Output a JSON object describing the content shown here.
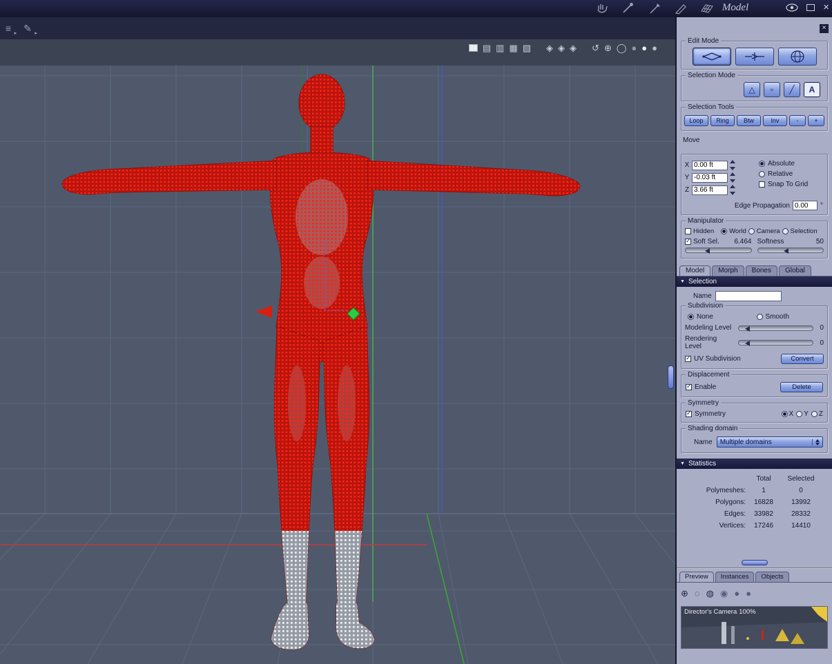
{
  "titlebar": {
    "title": "Model",
    "close": "×"
  },
  "viewport": {
    "left_tools": [
      {
        "name": "mixer-tool-icon",
        "glyph": "≡",
        "arrow": "▸"
      },
      {
        "name": "pen-tool-icon",
        "glyph": "✎",
        "arrow": "▸"
      }
    ],
    "toolbar": [
      {
        "name": "display-split-2-icon",
        "glyph": "▤"
      },
      {
        "name": "display-split-3-icon",
        "glyph": "▥"
      },
      {
        "name": "display-split-4-icon",
        "glyph": "▦"
      },
      {
        "name": "display-split-grid-icon",
        "glyph": "▧"
      },
      {
        "name": "shade-facet-1-icon",
        "glyph": "◈"
      },
      {
        "name": "shade-facet-2-icon",
        "glyph": "◈"
      },
      {
        "name": "shade-facet-3-icon",
        "glyph": "◈"
      },
      {
        "name": "orbit-icon",
        "glyph": "↺"
      },
      {
        "name": "dotted-cross-icon",
        "glyph": "⊕"
      },
      {
        "name": "wire-sphere-icon",
        "glyph": "◯"
      },
      {
        "name": "gray-sphere-icon",
        "glyph": "●"
      },
      {
        "name": "white-sphere-icon",
        "glyph": "●"
      },
      {
        "name": "shaded-sphere-icon",
        "glyph": "●"
      }
    ]
  },
  "panel": {
    "close": "×",
    "edit_mode": {
      "label": "Edit Mode"
    },
    "selection_mode": {
      "label": "Selection Mode",
      "buttons": [
        "△",
        "▫",
        "╱",
        "A"
      ]
    },
    "selection_tools": {
      "label": "Selection Tools",
      "buttons": [
        "Loop",
        "Ring",
        "Btw",
        "Inv",
        "-",
        "+"
      ]
    },
    "move": {
      "label": "Move",
      "x": {
        "label": "X",
        "value": "0.00 ft"
      },
      "y": {
        "label": "Y",
        "value": "-0.03 ft"
      },
      "z": {
        "label": "Z",
        "value": "3.66 ft"
      },
      "absolute": "Absolute",
      "relative": "Relative",
      "snap": "Snap To Grid",
      "edge_label": "Edge Propagation",
      "edge_value": "0.00",
      "degree": "°"
    },
    "manipulator": {
      "label": "Manipulator",
      "hidden": "Hidden",
      "world": "World",
      "camera": "Camera",
      "selection": "Selection",
      "soft_sel": "Soft Sel.",
      "soft_val": "6.464",
      "softness": "Softness",
      "softness_val": "50"
    },
    "tabs": [
      "Model",
      "Morph",
      "Bones",
      "Global"
    ],
    "selection_header": "Selection",
    "name_label": "Name",
    "subdivision": {
      "label": "Subdivision",
      "none": "None",
      "smooth": "Smooth",
      "modeling": "Modeling Level",
      "modeling_val": "0",
      "rendering": "Rendering Level",
      "rendering_val": "0",
      "uv": "UV Subdivision",
      "convert": "Convert"
    },
    "displacement": {
      "label": "Displacement",
      "enable": "Enable",
      "delete": "Delete"
    },
    "symmetry": {
      "label": "Symmetry",
      "checkbox": "Symmetry",
      "x": "X",
      "y": "Y",
      "z": "Z"
    },
    "shading": {
      "label": "Shading domain",
      "name": "Name",
      "value": "Multiple domains"
    },
    "statistics": {
      "header": "Statistics",
      "col_total": "Total",
      "col_selected": "Selected",
      "rows": [
        {
          "label": "Polymeshes:",
          "total": "1",
          "selected": "0"
        },
        {
          "label": "Polygons:",
          "total": "16828",
          "selected": "13992"
        },
        {
          "label": "Edges:",
          "total": "33982",
          "selected": "28332"
        },
        {
          "label": "Vertices:",
          "total": "17246",
          "selected": "14410"
        }
      ]
    },
    "bottom_tabs": [
      "Preview",
      "Instances",
      "Objects"
    ],
    "preview": {
      "icons": [
        {
          "name": "target-icon",
          "glyph": "⊕"
        },
        {
          "name": "dotted-sphere-icon",
          "glyph": "◌"
        },
        {
          "name": "wire-sphere-icon",
          "glyph": "◍"
        },
        {
          "name": "shaded-sphere-icon",
          "glyph": "◉"
        },
        {
          "name": "gray-sphere-icon",
          "glyph": "●"
        },
        {
          "name": "dark-sphere-icon",
          "glyph": "●"
        }
      ],
      "camera": "Director's Camera",
      "zoom": "100%"
    }
  }
}
